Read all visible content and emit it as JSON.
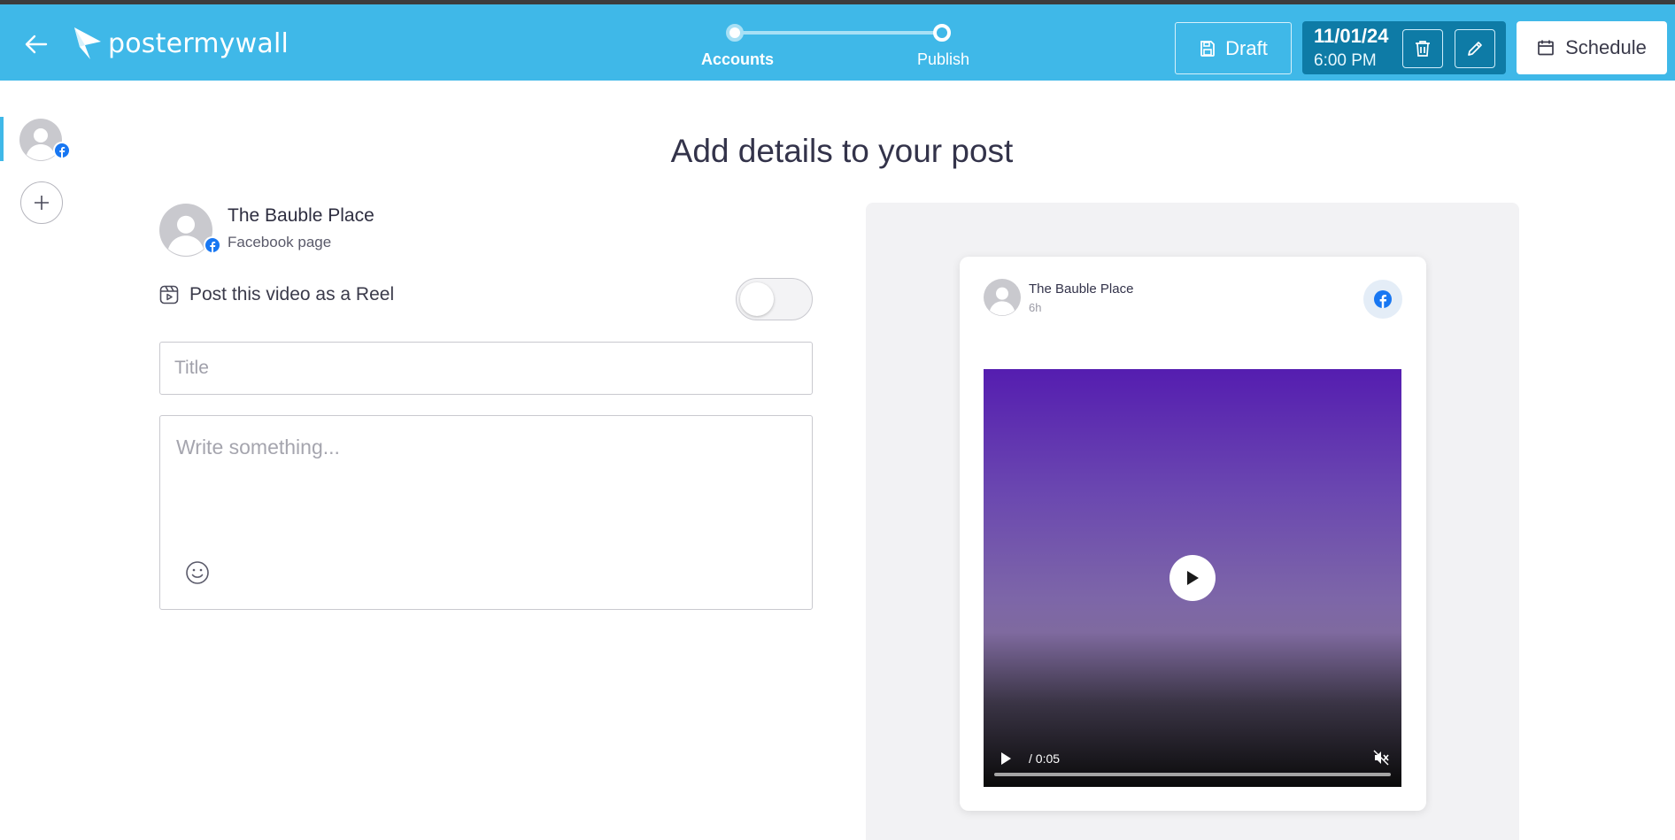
{
  "brand": {
    "logo_text": "postermywall",
    "accent": "#3fb8e8",
    "dark_accent": "#0e7ba6"
  },
  "header": {
    "steps": [
      {
        "label": "Accounts"
      },
      {
        "label": "Publish"
      }
    ],
    "draft_label": "Draft",
    "schedule_date": "11/01/24",
    "schedule_time": "6:00 PM",
    "schedule_label": "Schedule"
  },
  "page": {
    "title": "Add details to your post"
  },
  "account": {
    "name": "The Bauble Place",
    "type": "Facebook page"
  },
  "reel": {
    "label": "Post this video as a Reel",
    "enabled": false
  },
  "form": {
    "title_placeholder": "Title",
    "description_placeholder": "Write something..."
  },
  "preview": {
    "name": "The Bauble Place",
    "time": "6h",
    "video": {
      "time_display": "/ 0:05",
      "muted": true
    }
  }
}
